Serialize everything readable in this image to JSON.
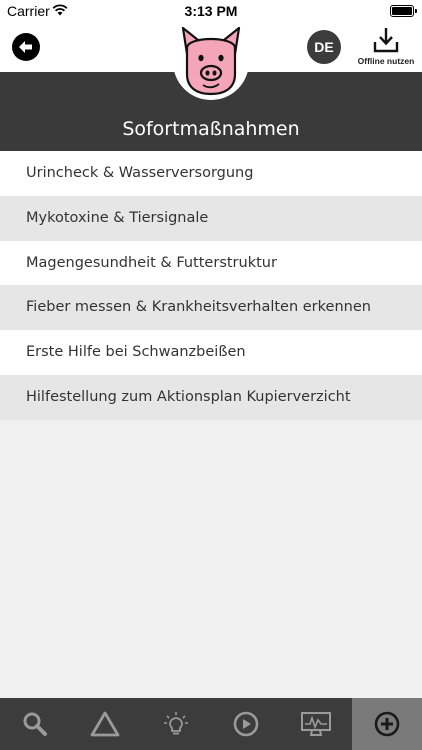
{
  "status_bar": {
    "carrier": "Carrier",
    "time": "3:13 PM"
  },
  "nav": {
    "back_icon": "arrow-left-circle-icon",
    "language": "DE",
    "offline_label": "Offline nutzen",
    "offline_icon": "download-icon",
    "logo_icon": "pig-logo-icon"
  },
  "header": {
    "title": "Sofortmaßnahmen"
  },
  "menu": {
    "items": [
      {
        "label": "Urincheck & Wasserversorgung"
      },
      {
        "label": "Mykotoxine & Tiersignale"
      },
      {
        "label": "Magengesundheit & Futterstruktur"
      },
      {
        "label": "Fieber messen & Krankheitsverhalten erkennen"
      },
      {
        "label": "Erste Hilfe bei Schwanzbeißen"
      },
      {
        "label": "Hilfestellung zum Aktionsplan Kupierverzicht"
      }
    ]
  },
  "tab_bar": {
    "tabs": [
      {
        "icon": "search-icon"
      },
      {
        "icon": "warning-triangle-icon"
      },
      {
        "icon": "lightbulb-icon"
      },
      {
        "icon": "play-circle-icon"
      },
      {
        "icon": "monitor-chart-icon"
      },
      {
        "icon": "plus-circle-icon",
        "active": true
      }
    ]
  },
  "colors": {
    "header_bg": "#3a3a3a",
    "tab_bar_bg": "#3c3c3c",
    "tab_active_bg": "#7a7a7a",
    "row_alt_bg": "#e6e6e6",
    "pig_pink": "#f4a6b8"
  }
}
